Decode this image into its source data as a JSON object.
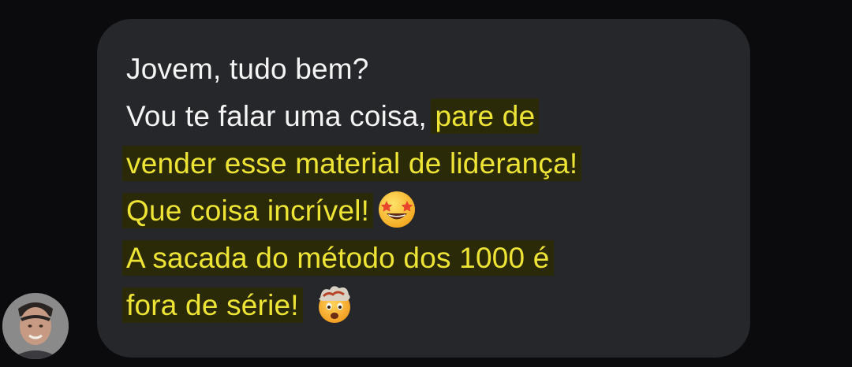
{
  "chat": {
    "message": {
      "line1": "Jovem, tudo bem?",
      "line2_plain": "Vou te falar uma coisa, ",
      "line2_highlight": "pare de",
      "line3_highlight": "vender esse material de liderança!",
      "line4_highlight": "Que coisa incrível!",
      "line5_highlight": "A sacada do método dos 1000 é",
      "line6_highlight": "fora de série!",
      "emoji_star": "star-struck-emoji",
      "emoji_mindblown": "exploding-head-emoji"
    },
    "colors": {
      "background": "#0b0b0d",
      "bubble": "#26272b",
      "text": "#ffffff",
      "highlight_text": "#ede436",
      "highlight_bg": "#2b2a08"
    },
    "sender_avatar": "avatar-photo"
  }
}
